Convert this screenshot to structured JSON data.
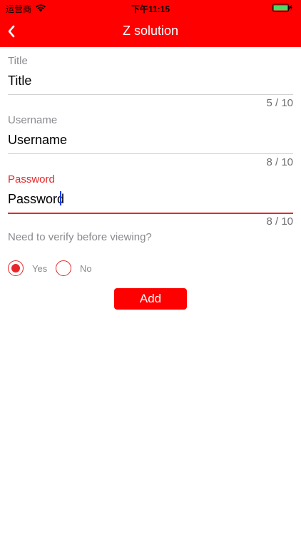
{
  "status_bar": {
    "carrier": "运营商",
    "time": "下午11:15",
    "icons": [
      "wifi-icon",
      "battery-icon"
    ]
  },
  "nav": {
    "back_icon": "chevron-left-icon",
    "title": "Z solution"
  },
  "form": {
    "fields": [
      {
        "label": "Title",
        "value": "Title",
        "counter": "5 / 10",
        "active": false
      },
      {
        "label": "Username",
        "value": "Username",
        "counter": "8 / 10",
        "active": false
      },
      {
        "label": "Password",
        "value": "Password",
        "counter": "8 / 10",
        "active": true
      }
    ],
    "verify_question": "Need to verify before viewing?",
    "options": [
      {
        "label": "Yes",
        "selected": true
      },
      {
        "label": "No",
        "selected": false
      }
    ],
    "submit_label": "Add"
  },
  "colors": {
    "accent": "#ff0000",
    "active_field": "#e8262a",
    "label_gray": "#8a8a8f",
    "caret": "#1a3cff"
  }
}
